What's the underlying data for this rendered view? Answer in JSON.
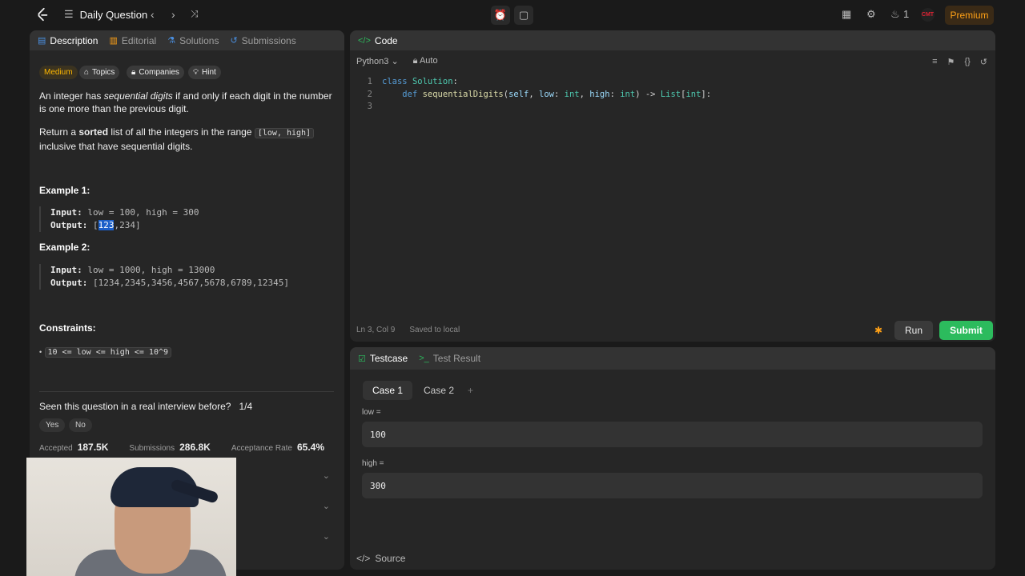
{
  "nav": {
    "title": "Daily Question",
    "streak": "1",
    "avatar_text": "CMT",
    "premium": "Premium"
  },
  "left_tabs": [
    "Description",
    "Editorial",
    "Solutions",
    "Submissions"
  ],
  "tags": {
    "difficulty": "Medium",
    "topics": "Topics",
    "companies": "Companies",
    "hint": "Hint"
  },
  "description": {
    "p1_a": "An integer has ",
    "p1_em": "sequential digits",
    "p1_b": " if and only if each digit in the number is one more than the previous digit.",
    "p2_a": "Return a ",
    "p2_b": "sorted",
    "p2_c": " list of all the integers in the range ",
    "p2_code": "[low, high]",
    "p2_d": " inclusive that have sequential digits."
  },
  "examples": [
    {
      "title": "Example 1:",
      "input_label": "Input:",
      "input": "low = 100, high = 300",
      "output_label": "Output:",
      "output_pre": "[",
      "output_sel": "123",
      "output_post": ",234]"
    },
    {
      "title": "Example 2:",
      "input_label": "Input:",
      "input": "low = 1000, high = 13000",
      "output_label": "Output:",
      "output": "[1234,2345,3456,4567,5678,6789,12345]"
    }
  ],
  "constraints": {
    "title": "Constraints:",
    "item": "10 <= low <= high <= 10^9"
  },
  "interview": {
    "question": "Seen this question in a real interview before?",
    "count": "1/4",
    "yes": "Yes",
    "no": "No"
  },
  "stats": {
    "accepted_label": "Accepted",
    "accepted": "187.5K",
    "submissions_label": "Submissions",
    "submissions": "286.8K",
    "rate_label": "Acceptance Rate",
    "rate": "65.4%"
  },
  "code": {
    "header": "Code",
    "language": "Python3",
    "mode": "Auto",
    "status_pos": "Ln 3, Col 9",
    "status_saved": "Saved to local",
    "run": "Run",
    "submit": "Submit"
  },
  "test": {
    "tab_testcase": "Testcase",
    "tab_result": "Test Result",
    "case1": "Case 1",
    "case2": "Case 2",
    "add": "+",
    "var1_label": "low =",
    "var1_value": "100",
    "var2_label": "high =",
    "var2_value": "300",
    "source": "Source"
  },
  "colors": {
    "accent_green": "#2cbb5d",
    "premium_orange": "#ffa116",
    "medium_yellow": "#ffb800",
    "bg": "#1a1a1a",
    "panel": "#262626"
  }
}
